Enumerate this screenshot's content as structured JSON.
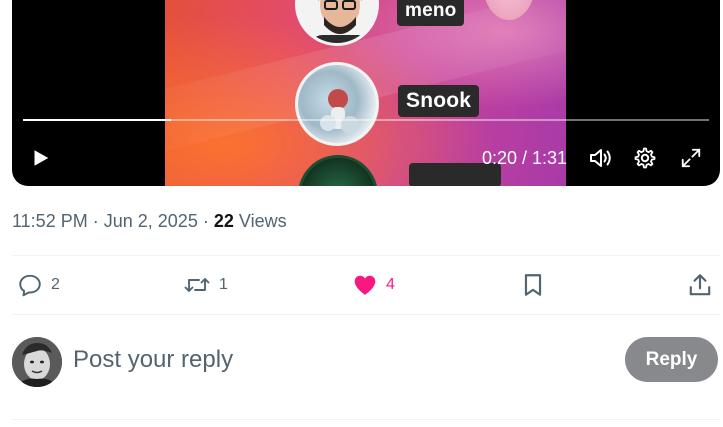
{
  "video": {
    "overlay": {
      "tag_top": "meno",
      "tag_middle": "Snook"
    },
    "progress_fraction": 0.216,
    "time_display": "0:20 / 1:31",
    "controls": {
      "play_icon": "play-icon",
      "volume_icon": "volume-icon",
      "settings_icon": "gear-icon",
      "fullscreen_icon": "fullscreen-icon"
    }
  },
  "meta": {
    "time": "11:52 PM",
    "separator": "·",
    "date": "Jun 2, 2025",
    "views_count": "22",
    "views_label": "Views"
  },
  "actions": {
    "reply_count": "2",
    "repost_count": "1",
    "like_count": "4",
    "like_color": "#f91880"
  },
  "composer": {
    "placeholder": "Post your reply",
    "reply_label": "Reply"
  }
}
